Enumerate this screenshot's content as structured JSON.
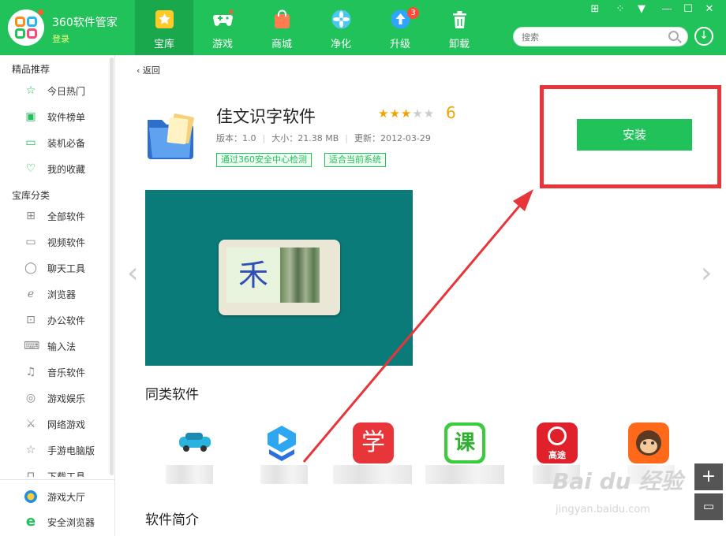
{
  "header": {
    "app_name": "360软件管家",
    "login_label": "登录",
    "search_placeholder": "搜索",
    "window_controls": [
      "skin-icon",
      "settings-icon",
      "menu-icon",
      "minimize-icon",
      "maximize-icon",
      "close-icon"
    ],
    "tabs": [
      {
        "label": "宝库",
        "icon": "star-icon",
        "active": true
      },
      {
        "label": "游戏",
        "icon": "gamepad-icon"
      },
      {
        "label": "商城",
        "icon": "shopping-bag-icon"
      },
      {
        "label": "净化",
        "icon": "fan-icon"
      },
      {
        "label": "升级",
        "icon": "upgrade-arrow-icon",
        "badge": "3"
      },
      {
        "label": "卸载",
        "icon": "trash-icon"
      }
    ]
  },
  "sidebar": {
    "section1": "精品推荐",
    "featured": [
      {
        "label": "今日热门",
        "icon": "star-outline-icon"
      },
      {
        "label": "软件榜单",
        "icon": "ranking-icon"
      },
      {
        "label": "装机必备",
        "icon": "monitor-icon"
      },
      {
        "label": "我的收藏",
        "icon": "heart-icon"
      }
    ],
    "section2": "宝库分类",
    "categories": [
      {
        "label": "全部软件",
        "icon": "grid-icon"
      },
      {
        "label": "视频软件",
        "icon": "video-icon"
      },
      {
        "label": "聊天工具",
        "icon": "chat-icon"
      },
      {
        "label": "浏览器",
        "icon": "browser-icon"
      },
      {
        "label": "办公软件",
        "icon": "briefcase-icon"
      },
      {
        "label": "输入法",
        "icon": "keyboard-icon"
      },
      {
        "label": "音乐软件",
        "icon": "music-icon"
      },
      {
        "label": "游戏娱乐",
        "icon": "gamepad-icon"
      },
      {
        "label": "网络游戏",
        "icon": "sword-icon"
      },
      {
        "label": "手游电脑版",
        "icon": "star-outline-icon"
      },
      {
        "label": "下载工具",
        "icon": "download-icon"
      }
    ],
    "bottom": [
      {
        "label": "游戏大厅",
        "icon": "game-hall-icon"
      },
      {
        "label": "安全浏览器",
        "icon": "ie-browser-icon"
      }
    ]
  },
  "detail": {
    "back_label": "返回",
    "title": "佳文识字软件",
    "rating_stars": 3,
    "rating_max": 5,
    "score": "6",
    "version": "版本：1.0",
    "size": "大小：21.38 MB",
    "updated": "更新：2012-03-29",
    "tags": [
      "通过360安全中心检测",
      "适合当前系统"
    ],
    "install_label": "安装",
    "screenshot_char": "禾"
  },
  "related": {
    "heading": "同类软件",
    "items": [
      {
        "icon": "car-icon",
        "label": "学"
      },
      {
        "icon": "graduation-cap-play-icon",
        "label": ""
      },
      {
        "icon": "xue-icon",
        "label": "学"
      },
      {
        "icon": "ke-icon",
        "label": "课"
      },
      {
        "icon": "gaotu-icon",
        "label": "高途"
      },
      {
        "icon": "monkey-icon",
        "label": ""
      }
    ]
  },
  "intro_heading": "软件简介",
  "watermark": {
    "main": "Bai du 经验",
    "sub": "jingyan.baidu.com"
  },
  "colors": {
    "brand": "#21c25a",
    "brand_dark": "#19a84c",
    "annotation": "#e8353a",
    "star": "#f0a400"
  }
}
